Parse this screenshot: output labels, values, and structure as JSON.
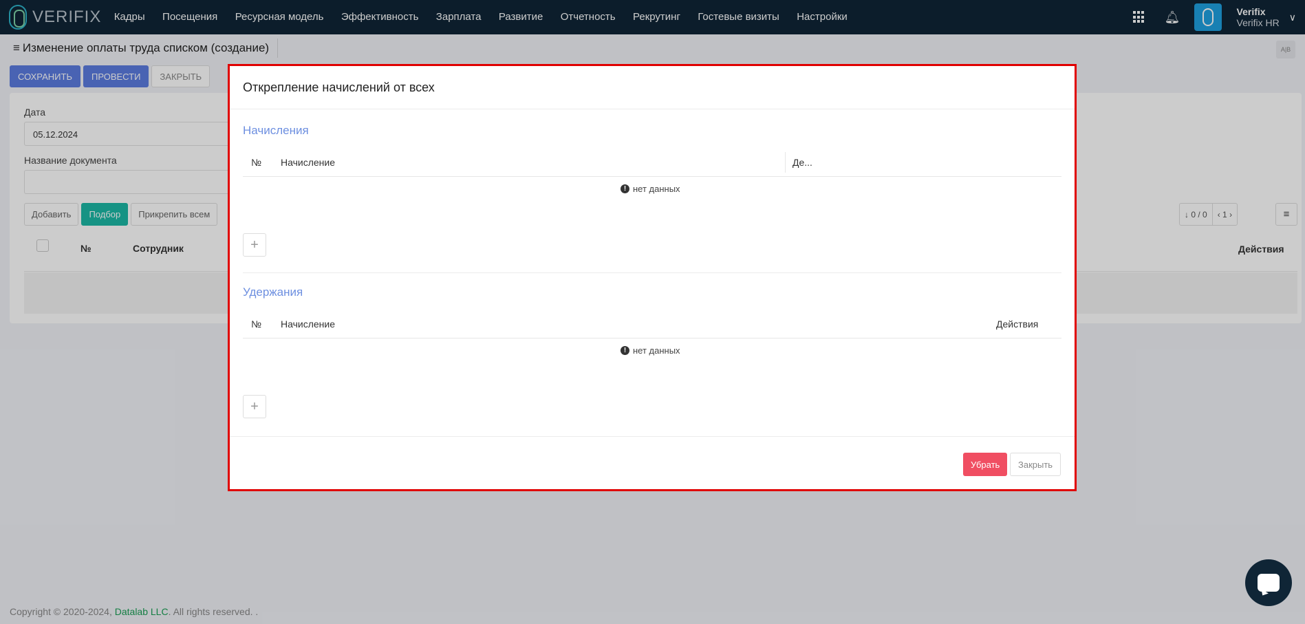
{
  "app": {
    "logo_text": "VERIFIX",
    "nav": [
      "Кадры",
      "Посещения",
      "Ресурсная модель",
      "Эффективность",
      "Зарплата",
      "Развитие",
      "Отчетность",
      "Рекрутинг",
      "Гостевые визиты",
      "Настройки"
    ],
    "user_name": "Verifix",
    "user_org": "Verifix HR"
  },
  "page": {
    "title": "Изменение оплаты труда списком (создание)",
    "lang_label": "A|B",
    "toolbar": {
      "save": "СОХРАНИТЬ",
      "post": "ПРОВЕСТИ",
      "close": "ЗАКРЫТЬ"
    },
    "date_label": "Дата",
    "date_value": "05.12.2024",
    "docname_label": "Название документа",
    "docname_value": "",
    "grid_buttons": {
      "add": "Добавить",
      "select": "Подбор",
      "attach_all": "Прикрепить всем"
    },
    "pager": {
      "count": "0 / 0",
      "page": "1"
    },
    "columns": {
      "num": "№",
      "employee": "Сотрудник",
      "actions": "Действия"
    }
  },
  "modal": {
    "title": "Открепление начислений от всех",
    "accruals": {
      "title": "Начисления",
      "col_num": "№",
      "col_name": "Начисление",
      "col_extra": "Де...",
      "empty": "нет данных"
    },
    "deductions": {
      "title": "Удержания",
      "col_num": "№",
      "col_name": "Начисление",
      "col_actions": "Действия",
      "empty": "нет данных"
    },
    "remove_label": "Убрать",
    "close_label": "Закрыть"
  },
  "footer": {
    "copyright": "Copyright © 2020-2024,",
    "company": "Datalab LLC",
    "rights": ". All rights reserved. ."
  },
  "colors": {
    "navbar": "#0f2536",
    "primary": "#5c7ce0",
    "teal": "#1cb8a6",
    "danger": "#f04e62",
    "highlight_border": "#e00000",
    "section_title": "#6d8fe0"
  }
}
